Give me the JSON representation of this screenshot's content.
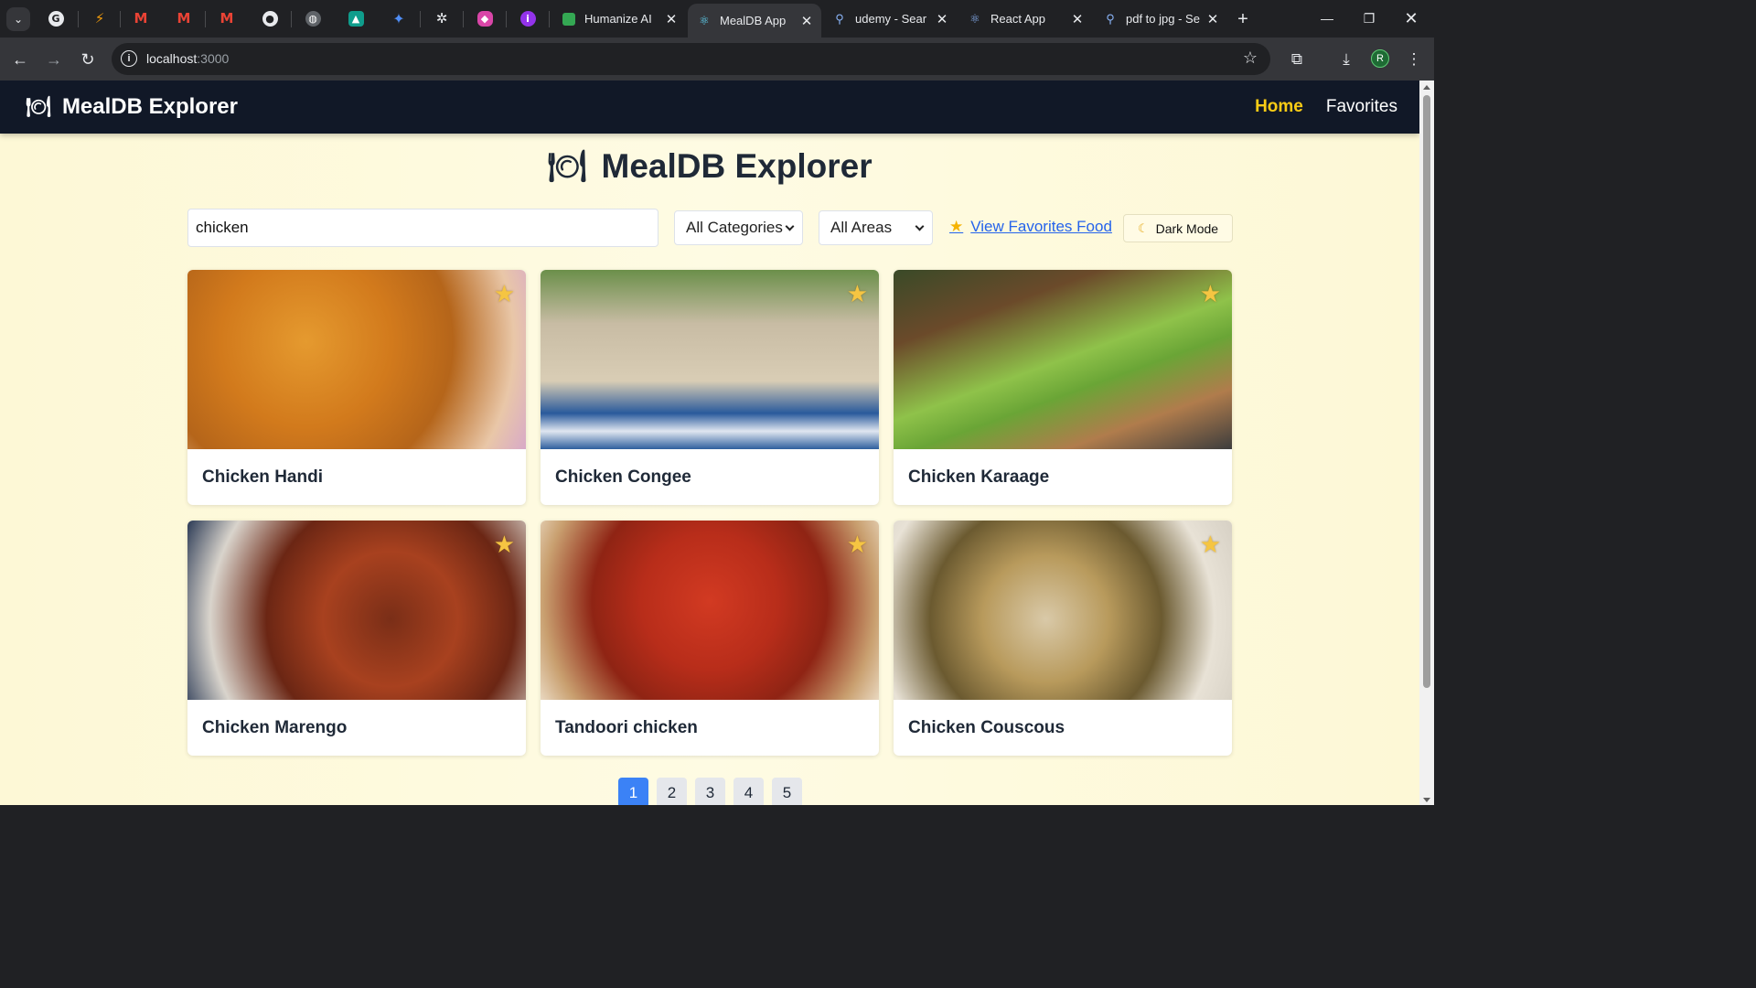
{
  "browser": {
    "tabs": [
      {
        "title": "Humanize AI",
        "favicon": "humanize-icon",
        "active": false
      },
      {
        "title": "MealDB App",
        "favicon": "react-icon",
        "active": true
      },
      {
        "title": "udemy - Sear",
        "favicon": "search-icon",
        "active": false
      },
      {
        "title": "React App",
        "favicon": "react-icon",
        "active": false
      },
      {
        "title": "pdf to jpg - Se",
        "favicon": "search-icon",
        "active": false
      }
    ],
    "pinned_tabs": [
      "chatgpt-icon",
      "flash-icon",
      "gmail-icon",
      "gmail-icon",
      "gmail-icon",
      "github-icon",
      "globe-icon",
      "graduation-icon",
      "gemini-icon",
      "openai-icon",
      "shield-icon",
      "extension-icon"
    ],
    "address": {
      "host": "localhost",
      "port": ":3000"
    },
    "profile_initial": "R"
  },
  "app": {
    "brand": "MealDB Explorer",
    "nav": {
      "home": "Home",
      "favorites": "Favorites"
    },
    "page_title": "MealDB Explorer",
    "search": {
      "value": "chicken"
    },
    "filters": {
      "category": "All Categories",
      "area": "All Areas"
    },
    "favorites_link": "View Favorites Food",
    "dark_mode_label": "Dark Mode",
    "accent_color": "#facc15",
    "link_color": "#2563eb",
    "meals": [
      {
        "name": "Chicken Handi"
      },
      {
        "name": "Chicken Congee"
      },
      {
        "name": "Chicken Karaage"
      },
      {
        "name": "Chicken Marengo"
      },
      {
        "name": "Tandoori chicken"
      },
      {
        "name": "Chicken Couscous"
      }
    ],
    "pagination": {
      "pages": [
        "1",
        "2",
        "3",
        "4",
        "5"
      ],
      "current": "1"
    }
  }
}
